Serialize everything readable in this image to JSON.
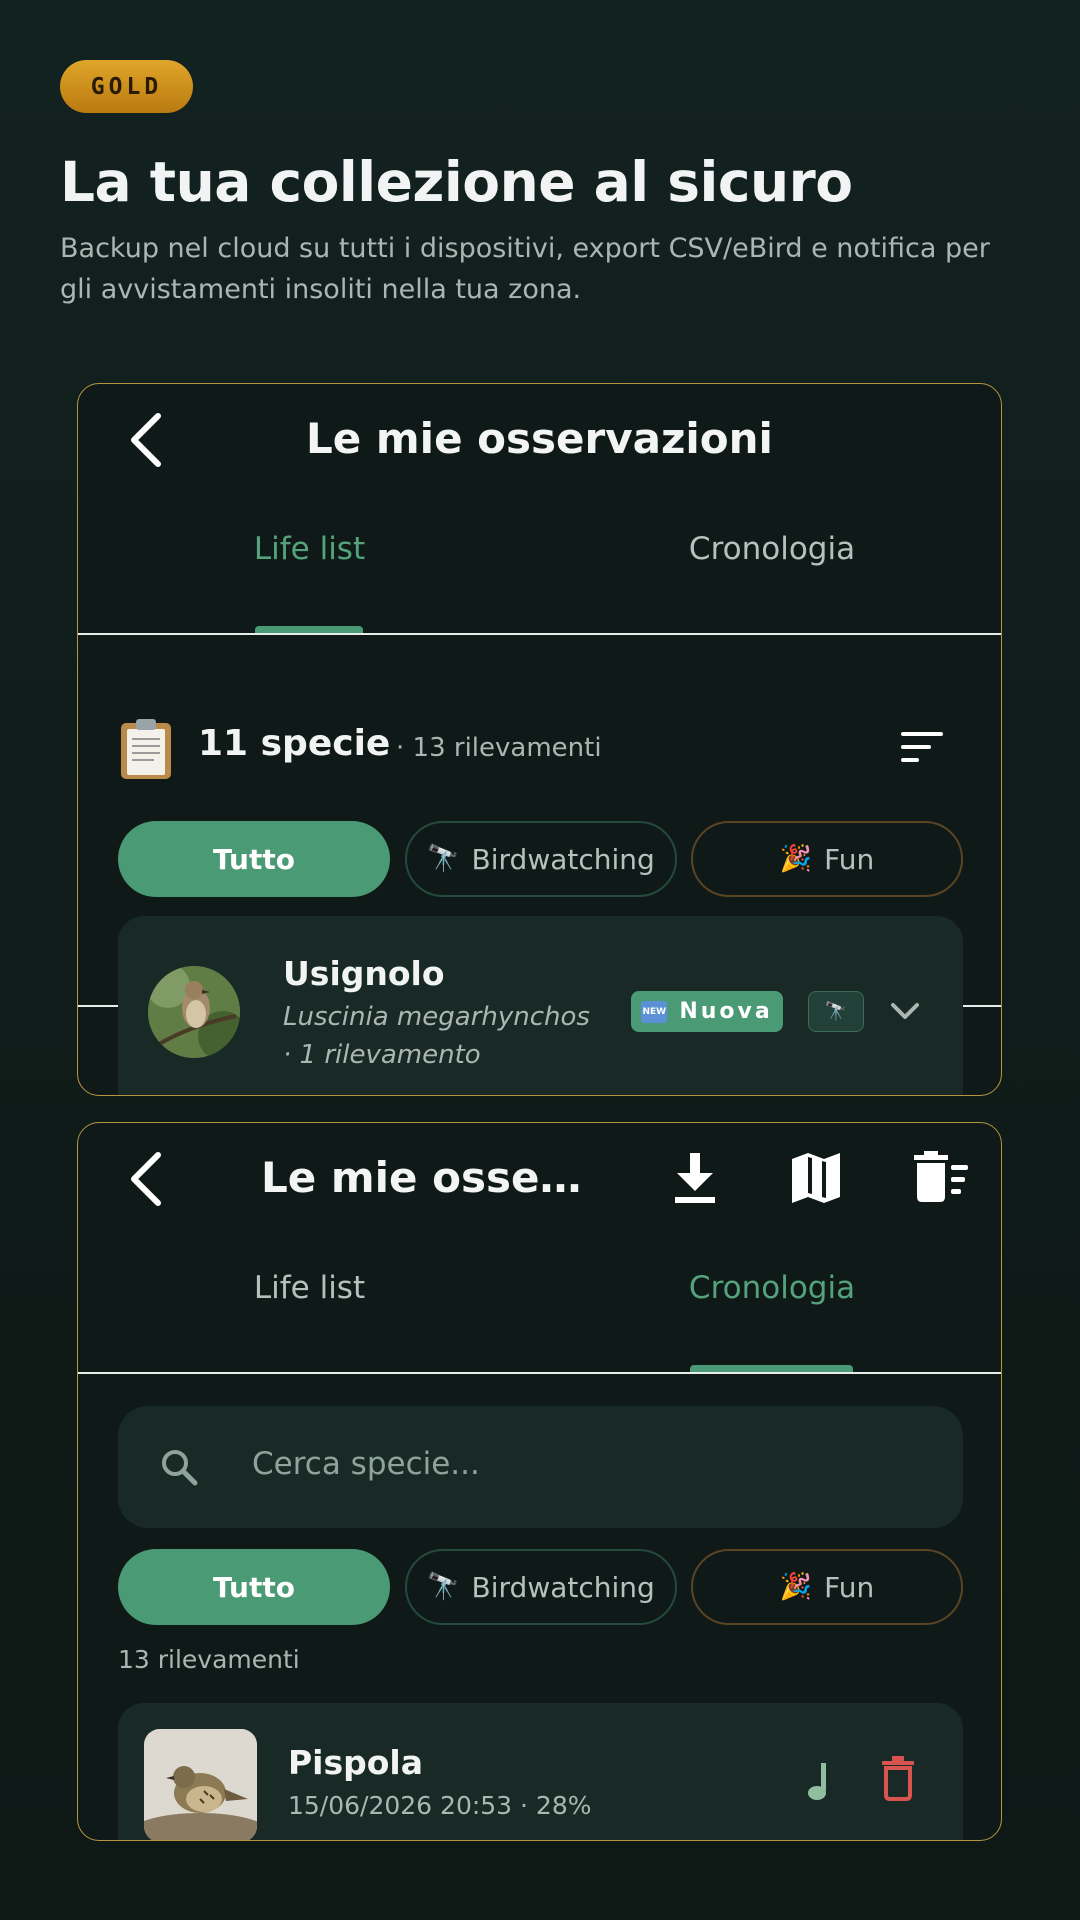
{
  "hero": {
    "badge": "GOLD",
    "title": "La tua collezione al sicuro",
    "subtitle": "Backup nel cloud su tutti i dispositivi, export CSV/eBird e notifica per gli avvistamenti insoliti nella tua zona."
  },
  "colors": {
    "accent_green": "#4a9a75",
    "gold_border": "#b79440",
    "background": "#112220",
    "card": "#192a26",
    "danger": "#d9534f"
  },
  "screen1": {
    "title": "Le mie osservazioni",
    "tabs": [
      {
        "label": "Life list",
        "active": true
      },
      {
        "label": "Cronologia",
        "active": false
      }
    ],
    "summary": {
      "icon": "clipboard-icon",
      "count": "11 specie",
      "sub": "· 13 rilevamenti"
    },
    "chips": [
      {
        "label": "Tutto",
        "selected": true
      },
      {
        "emoji": "🔭",
        "label": "Birdwatching",
        "selected": false
      },
      {
        "emoji": "🎉",
        "label": "Fun",
        "selected": false
      }
    ],
    "card": {
      "name": "Usignolo",
      "scientific": "Luscinia megarhynchos",
      "count": "· 1 rilevamento",
      "new_icon": "NEW",
      "badge": "Nuova",
      "mode_icon": "🔭"
    }
  },
  "screen2": {
    "title": "Le mie osservazioni",
    "title_display": "Le mie osser...",
    "actions": [
      "download-icon",
      "map-icon",
      "delete-sweep-icon"
    ],
    "tabs": [
      {
        "label": "Life list",
        "active": false
      },
      {
        "label": "Cronologia",
        "active": true
      }
    ],
    "search": {
      "placeholder": "Cerca specie..."
    },
    "chips": [
      {
        "label": "Tutto",
        "selected": true
      },
      {
        "emoji": "🔭",
        "label": "Birdwatching",
        "selected": false
      },
      {
        "emoji": "🎉",
        "label": "Fun",
        "selected": false
      }
    ],
    "count_label": "13 rilevamenti",
    "card": {
      "name": "Pispola",
      "meta": "15/06/2026 20:53 · 28%"
    }
  }
}
